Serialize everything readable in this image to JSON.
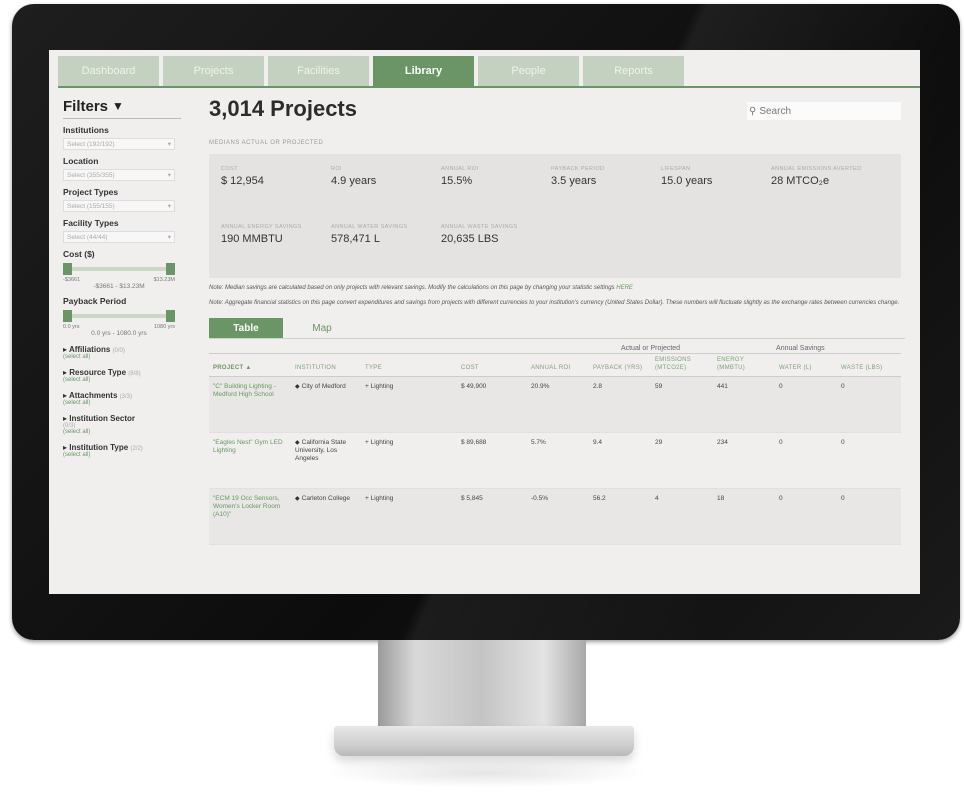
{
  "tabs": [
    "Dashboard",
    "Projects",
    "Facilities",
    "Library",
    "People",
    "Reports"
  ],
  "active_tab": "Library",
  "filters": {
    "title": "Filters",
    "institutions": {
      "label": "Institutions",
      "value": "Select (192/192)"
    },
    "location": {
      "label": "Location",
      "value": "Select (355/355)"
    },
    "project_types": {
      "label": "Project Types",
      "value": "Select (155/155)"
    },
    "facility_types": {
      "label": "Facility Types",
      "value": "Select (44/44)"
    },
    "cost": {
      "label": "Cost ($)",
      "min": "-$3661",
      "max": "$13.23M",
      "range": "-$3661 - $13.23M"
    },
    "payback": {
      "label": "Payback Period",
      "min": "0.0 yrs",
      "max": "1080 yrs",
      "range": "0.0 yrs - 1080.0 yrs"
    },
    "expanders": [
      {
        "label": "Affiliations",
        "count": "(0/0)",
        "sub": "(select all)"
      },
      {
        "label": "Resource Type",
        "count": "(8/8)",
        "sub": "(select all)"
      },
      {
        "label": "Attachments",
        "count": "(3/3)",
        "sub": "(select all)"
      },
      {
        "label": "Institution Sector",
        "count": "(0/3)",
        "sub": "(select all)"
      },
      {
        "label": "Institution Type",
        "count": "(2/2)",
        "sub": "(select all)"
      }
    ]
  },
  "main": {
    "title": "3,014 Projects",
    "search_placeholder": "Search",
    "section_label": "MEDIANS ACTUAL OR PROJECTED",
    "stats_row1": [
      {
        "label": "COST",
        "value": "$ 12,954"
      },
      {
        "label": "ROI",
        "value": "4.9 years"
      },
      {
        "label": "ANNUAL ROI",
        "value": "15.5%"
      },
      {
        "label": "PAYBACK PERIOD",
        "value": "3.5 years"
      },
      {
        "label": "LIFESPAN",
        "value": "15.0 years"
      },
      {
        "label": "ANNUAL EMISSIONS AVERTED",
        "value": "28 MTCO₂e"
      }
    ],
    "stats_row2": [
      {
        "label": "ANNUAL ENERGY SAVINGS",
        "value": "190 MMBTU"
      },
      {
        "label": "ANNUAL WATER SAVINGS",
        "value": "578,471 L"
      },
      {
        "label": "ANNUAL WASTE SAVINGS",
        "value": "20,635 LBS"
      }
    ],
    "note1": "Note: Median savings are calculated based on only projects with relevant savings. Modify the calculations on this page by changing your statistic settings",
    "note1_link": "HERE",
    "note2": "Note: Aggregate financial statistics on this page convert expenditures and savings from projects with different currencies to your institution's currency (United States Dollar). These numbers will fluctuate slightly as the exchange rates between currencies change.",
    "view_tabs": [
      "Table",
      "Map"
    ]
  },
  "table": {
    "group_headers": [
      "Actual or Projected",
      "Annual Savings"
    ],
    "columns": [
      "PROJECT ▲",
      "INSTITUTION",
      "TYPE",
      "COST",
      "ANNUAL ROI",
      "PAYBACK (YRS)",
      "EMISSIONS (MTCO2E)",
      "ENERGY (MMBTU)",
      "WATER (L)",
      "WASTE (LBS)"
    ],
    "rows": [
      {
        "project": "\"C\" Building Lighting - Medford High School",
        "institution": "City of Medford",
        "type": "+ Lighting",
        "cost": "$ 49,900",
        "roi": "20.9%",
        "payback": "2.8",
        "emissions": "59",
        "energy": "441",
        "water": "0",
        "waste": "0"
      },
      {
        "project": "\"Eagles Nest\" Gym LED Lighting",
        "institution": "California State University, Los Angeles",
        "type": "+ Lighting",
        "cost": "$ 89,688",
        "roi": "5.7%",
        "payback": "9.4",
        "emissions": "29",
        "energy": "234",
        "water": "0",
        "waste": "0"
      },
      {
        "project": "\"ECM 19 Occ Sensors, Women's Locker Room (A10)\"",
        "institution": "Carleton College",
        "type": "+ Lighting",
        "cost": "$ 5,845",
        "roi": "-0.5%",
        "payback": "56.2",
        "emissions": "4",
        "energy": "18",
        "water": "0",
        "waste": "0"
      }
    ]
  },
  "colors": {
    "accent": "#6b9566",
    "tab_inactive": "#c5d1c0",
    "screen_bg": "#f1efee",
    "stats_bg": "#e5e3e1"
  }
}
